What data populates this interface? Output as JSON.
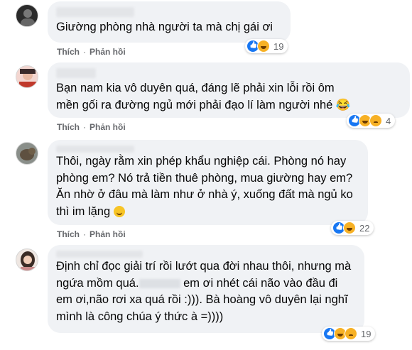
{
  "actions": {
    "like_label": "Thích",
    "separator": "·",
    "reply_label": "Phản hồi"
  },
  "comments": [
    {
      "text": "Giường phòng nhà người ta mà chị gái ơi",
      "reactions": [
        "like-icon",
        "haha-icon"
      ],
      "reaction_count": "19"
    },
    {
      "text": "Bạn nam kia vô duyên quá, đáng lẽ phải xin lỗi rồi ôm\nmền gối ra đường ngủ mới phải đạo lí làm người nhé 😂",
      "reactions": [
        "like-icon",
        "haha-icon",
        "sad-icon"
      ],
      "reaction_count": "4"
    },
    {
      "text": "Thôi, ngày rằm xin phép khẩu nghiệp cái. Phòng nó hay\nphòng em? Nó trả tiền thuê phòng, mua giường hay em?\nĂn nhờ ở đâu mà làm như ở nhà ý, xuống đất mà ngủ ko\nthì im lặng",
      "reactions": [
        "like-icon",
        "haha-icon"
      ],
      "reaction_count": "22"
    },
    {
      "text_a": "Định chỉ đọc giải trí rồi lướt qua đời nhau thôi, nhưng mà\nngứa mồm quá.",
      "text_b": " em ơi nhét cái não vào đầu đi\nem ơi,não rơi xa quá rồi :))). Bà hoàng vô duyên lại nghĩ\nmình là công chúa ý thức à =))))",
      "reactions": [
        "like-icon",
        "haha-icon",
        "sad-icon"
      ],
      "reaction_count": "19"
    }
  ]
}
